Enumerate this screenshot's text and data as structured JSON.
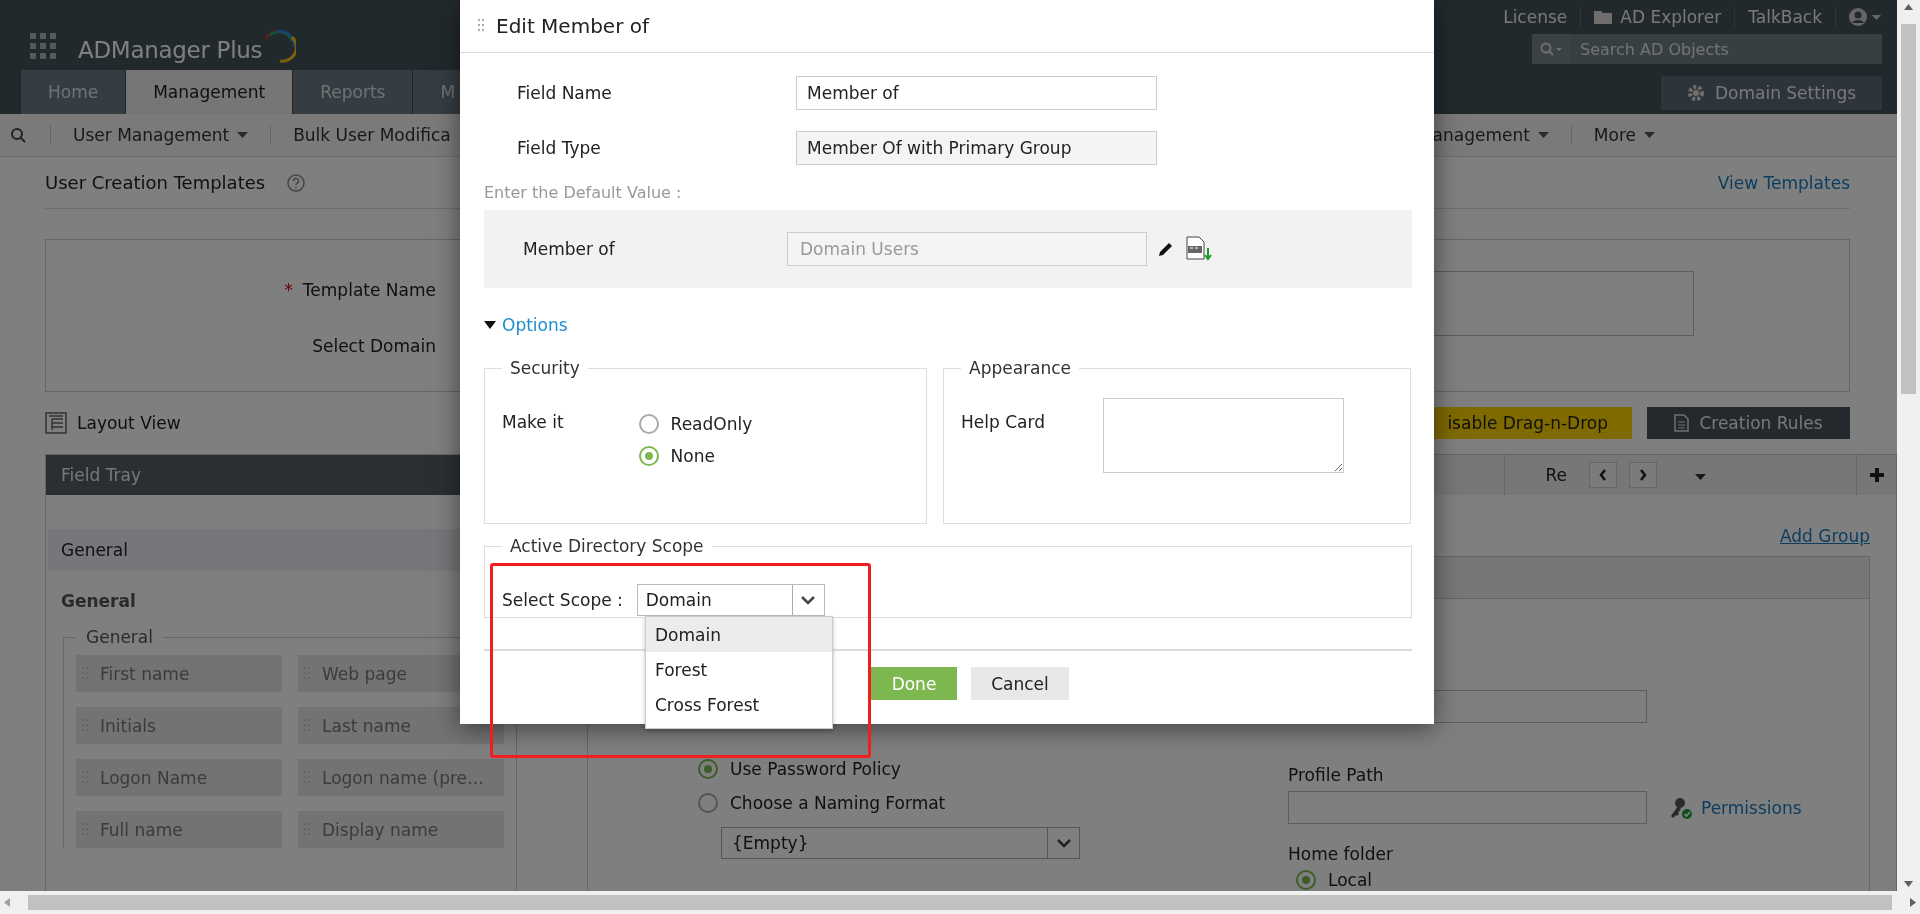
{
  "header": {
    "logo": "ADManager Plus",
    "links": [
      {
        "label": "License",
        "kind": "text"
      },
      {
        "label": "AD Explorer",
        "kind": "folder"
      },
      {
        "label": "TalkBack",
        "kind": "text"
      }
    ],
    "search": {
      "placeholder": "Search AD Objects"
    },
    "domain_settings": "Domain Settings",
    "tabs": [
      {
        "label": "Home",
        "selected": false
      },
      {
        "label": "Management",
        "selected": true
      },
      {
        "label": "Reports",
        "selected": false
      },
      {
        "label": "M",
        "selected": false
      }
    ]
  },
  "subnav": {
    "left": [
      {
        "label": "User Management",
        "dropdown": true
      },
      {
        "label": "Bulk User Modifica",
        "dropdown": false
      }
    ],
    "right": [
      {
        "label": "anagement",
        "dropdown": true
      },
      {
        "label": "More",
        "dropdown": true
      }
    ]
  },
  "page": {
    "title": "User Creation Templates",
    "view_templates": "View Templates",
    "form": [
      {
        "label": "Template Name",
        "marker": "*"
      },
      {
        "label": "Select Domain"
      }
    ],
    "layout_view": "Layout View",
    "drag_button": "isable Drag-n-Drop",
    "rules_button": "Creation Rules"
  },
  "field_tray": {
    "title": "Field Tray",
    "section": "General",
    "group": "General",
    "fieldset": "General",
    "fields": [
      "First name",
      "Web page",
      "Initials",
      "Last name",
      "Logon Name",
      "Logon name (pre…",
      "Full name",
      "Display name"
    ]
  },
  "editor": {
    "tab_label": "Re",
    "add_group": "Add Group",
    "naming": [
      {
        "label": "Use Password Policy",
        "selected": true
      },
      {
        "label": "Choose a Naming Format",
        "selected": false
      }
    ],
    "naming_select": "{Empty}",
    "profile_path": "Profile Path",
    "permissions": "Permissions",
    "home_folder": "Home folder",
    "home_radio": {
      "label": "Local",
      "selected": true
    }
  },
  "modal": {
    "title": "Edit Member of",
    "field_name": {
      "label": "Field Name",
      "value": "Member of"
    },
    "field_type": {
      "label": "Field Type",
      "value": "Member Of with Primary Group"
    },
    "default_label": "Enter the Default Value :",
    "member_of": {
      "label": "Member of",
      "value": "Domain Users"
    },
    "options": {
      "label": "Options",
      "expanded": true
    },
    "security": {
      "legend": "Security",
      "make_it": "Make it",
      "radios": [
        {
          "label": "ReadOnly",
          "selected": false
        },
        {
          "label": "None",
          "selected": true
        }
      ]
    },
    "appearance": {
      "legend": "Appearance",
      "help_card": "Help Card"
    },
    "scope": {
      "legend": "Active Directory Scope",
      "label": "Select Scope :",
      "value": "Domain",
      "open": true,
      "options": [
        {
          "label": "Domain",
          "selected": true
        },
        {
          "label": "Forest",
          "selected": false
        },
        {
          "label": "Cross Forest",
          "selected": false
        }
      ]
    },
    "done": "Done",
    "cancel": "Cancel"
  }
}
